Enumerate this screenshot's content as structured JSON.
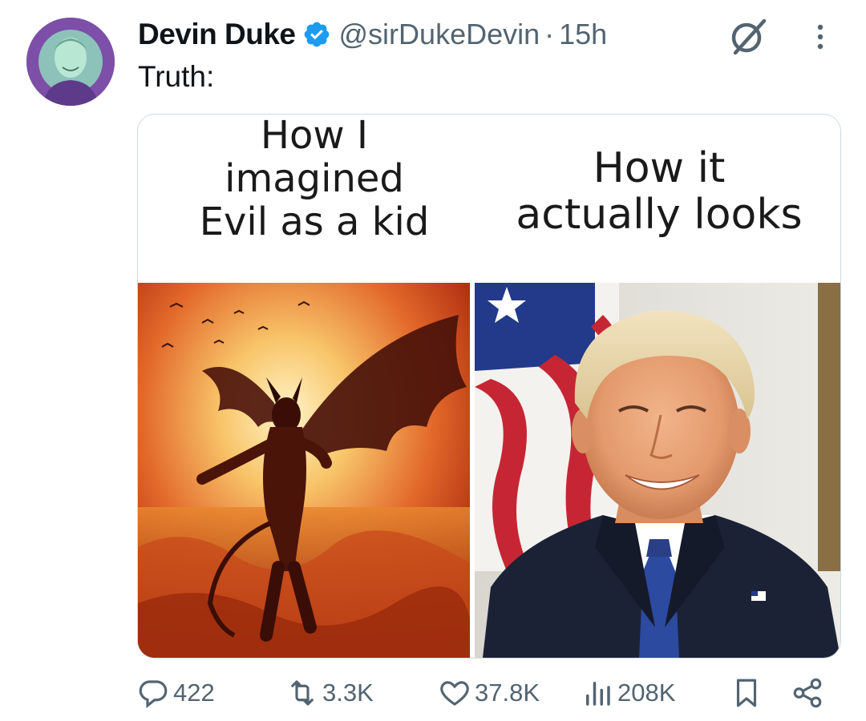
{
  "author": {
    "display_name": "Devin Duke",
    "handle": "@sirDukeDevin",
    "separator": "·",
    "time": "15h",
    "verified": true
  },
  "tweet": {
    "text": "Truth:"
  },
  "meme": {
    "left_caption": [
      "How I",
      "imagined",
      "Evil as a kid"
    ],
    "right_caption": [
      "How it",
      "actually looks"
    ]
  },
  "actions": {
    "replies": "422",
    "reposts": "3.3K",
    "likes": "37.8K",
    "views": "208K"
  },
  "icons": {
    "verified": "verified-badge-icon",
    "grok": "grok-icon",
    "more": "more-vertical-icon",
    "reply": "reply-icon",
    "repost": "repost-icon",
    "like": "heart-icon",
    "views": "views-chart-icon",
    "bookmark": "bookmark-icon",
    "share": "share-icon"
  },
  "colors": {
    "accent": "#1d9bf0",
    "text_primary": "#0f1419",
    "text_secondary": "#536471"
  }
}
